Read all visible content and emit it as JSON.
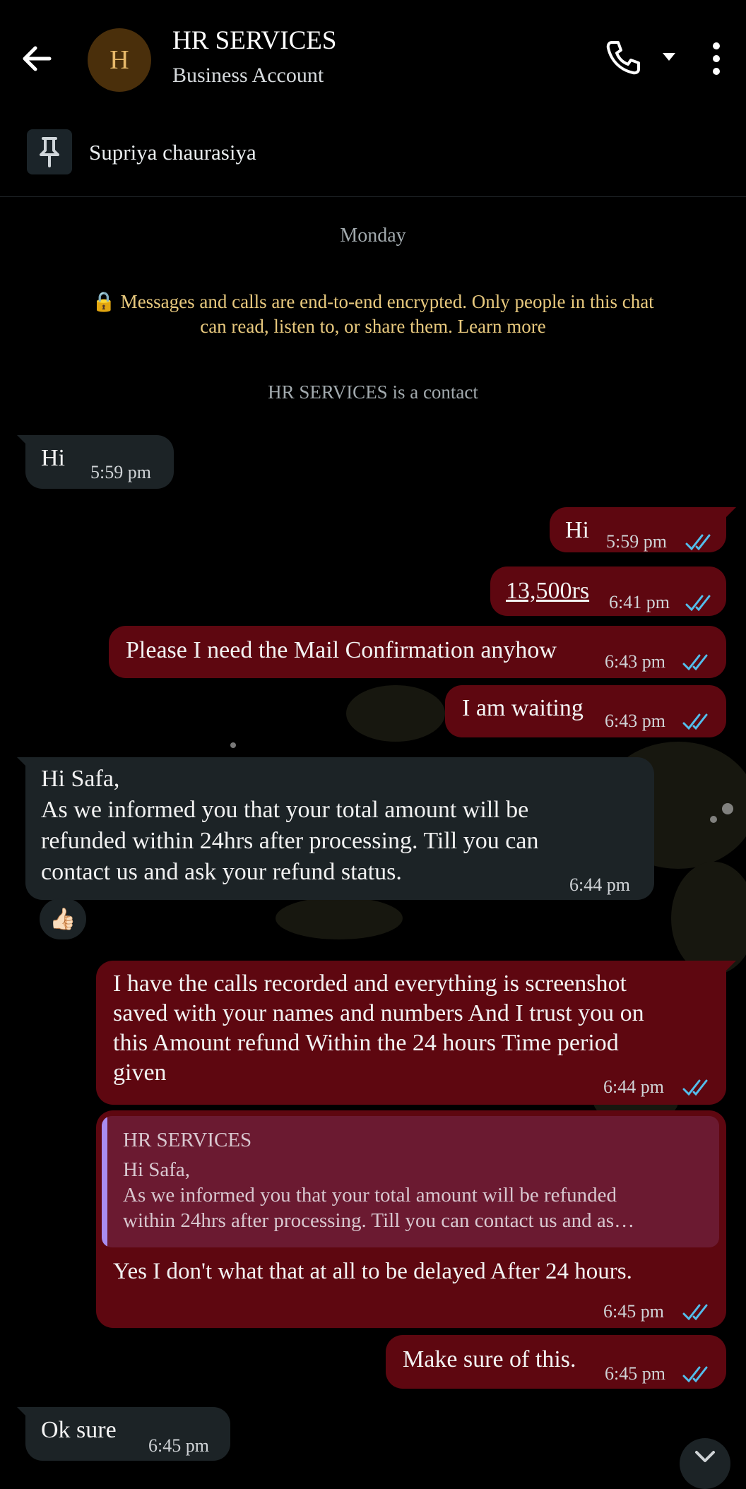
{
  "header": {
    "avatar_letter": "H",
    "title": "HR SERVICES",
    "subtitle": "Business Account"
  },
  "pinned": {
    "text": "Supriya chaurasiya"
  },
  "day_label": "Monday",
  "encryption_notice": "🔒 Messages and calls are end-to-end encrypted. Only people in this chat can read, listen to, or share them. Learn more",
  "contact_notice": "HR SERVICES is a contact",
  "messages": {
    "m1": {
      "text": "Hi",
      "time": "5:59 pm"
    },
    "m2": {
      "text": "Hi",
      "time": "5:59 pm"
    },
    "m3": {
      "text": "13,500rs",
      "time": "6:41 pm"
    },
    "m4": {
      "text": "Please I need the Mail Confirmation anyhow",
      "time": "6:43 pm"
    },
    "m5": {
      "text": "I am waiting",
      "time": "6:43 pm"
    },
    "m6": {
      "line1": "Hi Safa,",
      "line2": "As we informed you that your total amount will be",
      "line3": "refunded within 24hrs after processing. Till you can",
      "line4": "contact us and ask your refund status.",
      "time": "6:44 pm",
      "reaction": "👍🏻"
    },
    "m7": {
      "line1": "I have the calls recorded and everything is screenshot",
      "line2": "saved with your names and numbers And I trust you on",
      "line3": "this Amount refund Within the 24 hours Time period",
      "line4": "given",
      "time": "6:44 pm"
    },
    "m8": {
      "quote_author": "HR SERVICES",
      "quote_line1": "Hi Safa,",
      "quote_line2": "As we informed you that your total amount will be refunded",
      "quote_line3": "within 24hrs after processing. Till you can contact us and as…",
      "text": "Yes I don't what that at all to be delayed After 24 hours.",
      "time": "6:45 pm"
    },
    "m9": {
      "text": "Make sure of this.",
      "time": "6:45 pm"
    },
    "m10": {
      "text": "Ok sure",
      "time": "6:45 pm"
    }
  },
  "colors": {
    "outgoing_bubble": "#5e0710",
    "incoming_bubble": "#1c2326",
    "read_ticks": "#53bdeb",
    "encryption_text": "#e8c97e"
  },
  "icons": [
    "back-arrow-icon",
    "phone-icon",
    "caret-down-icon",
    "more-vert-icon",
    "pin-icon",
    "lock-icon",
    "double-check-icon",
    "chevron-down-icon"
  ]
}
